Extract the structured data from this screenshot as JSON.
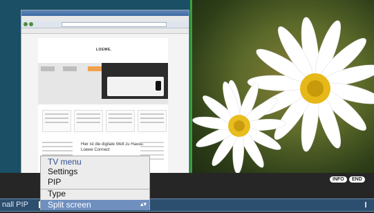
{
  "menu": {
    "title": "TV menu",
    "items": [
      "Settings",
      "PIP",
      "Type"
    ],
    "selected": "Split screen"
  },
  "status": {
    "left_label": "nall PIP"
  },
  "keys": {
    "info": "INFO",
    "end": "END"
  },
  "browser": {
    "logo": "LOEWE.",
    "headline_1": "Hier ist die digitale Welt zu Hause.",
    "headline_2": "Loewe Connect"
  },
  "colors": {
    "left_pane": "#1a4f66",
    "divider": "#3aa33a",
    "status_bar": "#2c4e6f",
    "menu_selected": "#6f90bf",
    "menu_title": "#2f4f8f"
  }
}
